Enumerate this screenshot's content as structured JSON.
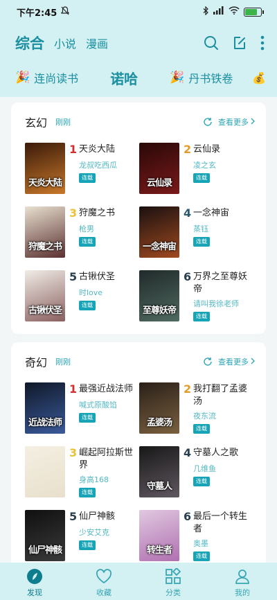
{
  "status": {
    "time": "下午2:45",
    "battery_level": 0.75
  },
  "header": {
    "tabs": [
      {
        "label": "综合",
        "active": true
      },
      {
        "label": "小说",
        "active": false
      },
      {
        "label": "漫画",
        "active": false
      }
    ],
    "icons": [
      "search-icon",
      "edit-icon",
      "more-vertical-icon"
    ]
  },
  "subnav": {
    "left": "连尚读书",
    "center": "诺哈",
    "right": "丹书铁卷"
  },
  "sections": [
    {
      "title": "玄幻",
      "subtitle": "刚刚",
      "more": "查看更多",
      "books": [
        {
          "rank": "1",
          "name": "天炎大陆",
          "author": "龙叔吃西瓜",
          "badge": "连载",
          "cover_text": "天炎大陆",
          "cover_colors": [
            "#3a1a0a",
            "#c8782a"
          ],
          "rank_color": "#d23030"
        },
        {
          "rank": "2",
          "name": "云仙录",
          "author": "凌之玄",
          "badge": "连载",
          "cover_text": "云仙录",
          "cover_colors": [
            "#2a0808",
            "#7a1a1a"
          ],
          "rank_color": "#e29b28"
        },
        {
          "rank": "3",
          "name": "狩魔之书",
          "author": "枪男",
          "badge": "连载",
          "cover_text": "狩魔之书",
          "cover_colors": [
            "#e8e0d0",
            "#5a3030"
          ],
          "rank_color": "#e8c238"
        },
        {
          "rank": "4",
          "name": "一念神宙",
          "author": "蒸钰",
          "badge": "连载",
          "cover_text": "一念神宙",
          "cover_colors": [
            "#1a1010",
            "#a04a20"
          ],
          "rank_color": "#2a5a70"
        },
        {
          "rank": "5",
          "name": "古锹伏圣",
          "author": "时love",
          "badge": "连载",
          "cover_text": "古锹伏圣",
          "cover_colors": [
            "#f0ece6",
            "#8a6060"
          ],
          "rank_color": "#2a4050"
        },
        {
          "rank": "6",
          "name": "万界之至尊妖帝",
          "author": "请叫我徐老师",
          "badge": "连载",
          "cover_text": "至尊妖帝",
          "cover_colors": [
            "#202a2a",
            "#506a60"
          ],
          "rank_color": "#2a4050"
        }
      ]
    },
    {
      "title": "奇幻",
      "subtitle": "刚刚",
      "more": "查看更多",
      "books": [
        {
          "rank": "1",
          "name": "最强近战法师",
          "author": "喊式原酸馅",
          "badge": "连载",
          "cover_text": "近战法师",
          "cover_colors": [
            "#101828",
            "#3a5a9a"
          ],
          "rank_color": "#d23030"
        },
        {
          "rank": "2",
          "name": "我打翻了孟婆汤",
          "author": "夜东流",
          "badge": "连载",
          "cover_text": "孟婆汤",
          "cover_colors": [
            "#2a2018",
            "#7a6040"
          ],
          "rank_color": "#e29b28"
        },
        {
          "rank": "3",
          "name": "崛起阿拉斯世界",
          "author": "身高168",
          "badge": "连载",
          "cover_text": "",
          "cover_colors": [
            "#f4efe2",
            "#e8e0cc"
          ],
          "rank_color": "#e8c238"
        },
        {
          "rank": "4",
          "name": "守墓人之歌",
          "author": "几维鱼",
          "badge": "连载",
          "cover_text": "守墓人",
          "cover_colors": [
            "#181818",
            "#605860"
          ],
          "rank_color": "#2a4050"
        },
        {
          "rank": "5",
          "name": "仙尸神骸",
          "author": "少安艾克",
          "badge": "连载",
          "cover_text": "仙尸神骸",
          "cover_colors": [
            "#101010",
            "#3a3a3a"
          ],
          "rank_color": "#2a4050"
        },
        {
          "rank": "6",
          "name": "最后一个转生者",
          "author": "奥墨",
          "badge": "连载",
          "cover_text": "转生者",
          "cover_colors": [
            "#e0c8e0",
            "#b070b0"
          ],
          "rank_color": "#2a4050"
        }
      ]
    }
  ],
  "bottom_nav": [
    {
      "label": "发现",
      "icon": "leaf-icon",
      "active": true
    },
    {
      "label": "收藏",
      "icon": "heart-icon",
      "active": false
    },
    {
      "label": "分类",
      "icon": "category-icon",
      "active": false
    },
    {
      "label": "我的",
      "icon": "user-icon",
      "active": false
    }
  ],
  "colors": {
    "accent": "#1b8fa0",
    "header_bg": "#d3f0f3",
    "badge": "#16a4b6"
  }
}
